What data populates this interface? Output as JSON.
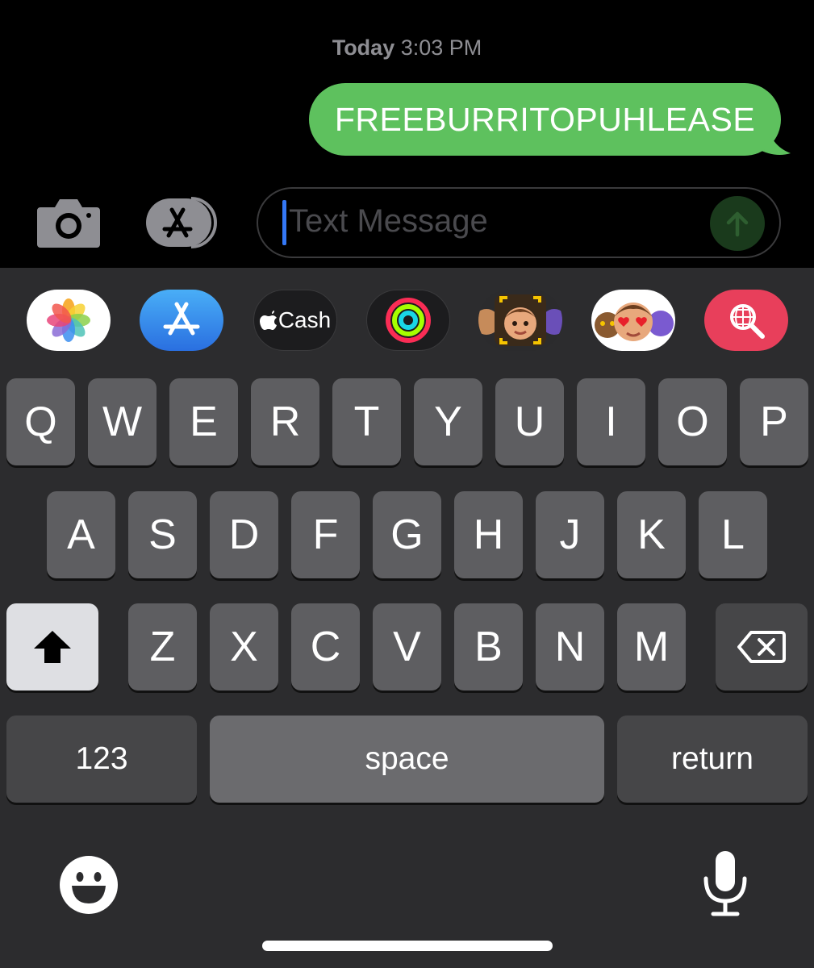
{
  "conversation": {
    "timestamp_day": "Today",
    "timestamp_time": "3:03 PM",
    "messages": [
      {
        "text": "FREEBURRITOPUHLEASE",
        "sender": "me",
        "color": "#5ec15e"
      }
    ]
  },
  "compose": {
    "camera_icon": "camera-icon",
    "apps_icon": "app-store-icon",
    "placeholder": "Text Message",
    "send_icon": "arrow-up-icon"
  },
  "app_drawer": [
    {
      "name": "photos",
      "icon": "photos-icon"
    },
    {
      "name": "app-store",
      "icon": "app-store-icon"
    },
    {
      "name": "apple-cash",
      "icon": "apple-logo-icon",
      "label": "Cash"
    },
    {
      "name": "activity",
      "icon": "activity-rings-icon"
    },
    {
      "name": "memoji",
      "icon": "memoji-icon"
    },
    {
      "name": "memoji-stickers",
      "icon": "memoji-stickers-icon"
    },
    {
      "name": "search-images",
      "icon": "globe-search-icon"
    }
  ],
  "keyboard": {
    "row1": [
      "Q",
      "W",
      "E",
      "R",
      "T",
      "Y",
      "U",
      "I",
      "O",
      "P"
    ],
    "row2": [
      "A",
      "S",
      "D",
      "F",
      "G",
      "H",
      "J",
      "K",
      "L"
    ],
    "row3": [
      "Z",
      "X",
      "C",
      "V",
      "B",
      "N",
      "M"
    ],
    "numbers_label": "123",
    "space_label": "space",
    "return_label": "return",
    "shift_icon": "shift-arrow-icon",
    "delete_icon": "delete-backspace-icon",
    "emoji_icon": "emoji-smiley-icon",
    "mic_icon": "microphone-icon"
  },
  "colors": {
    "imessage_green": "#5ec15e",
    "caret_blue": "#3478f6",
    "keyboard_bg": "#2c2c2e"
  }
}
